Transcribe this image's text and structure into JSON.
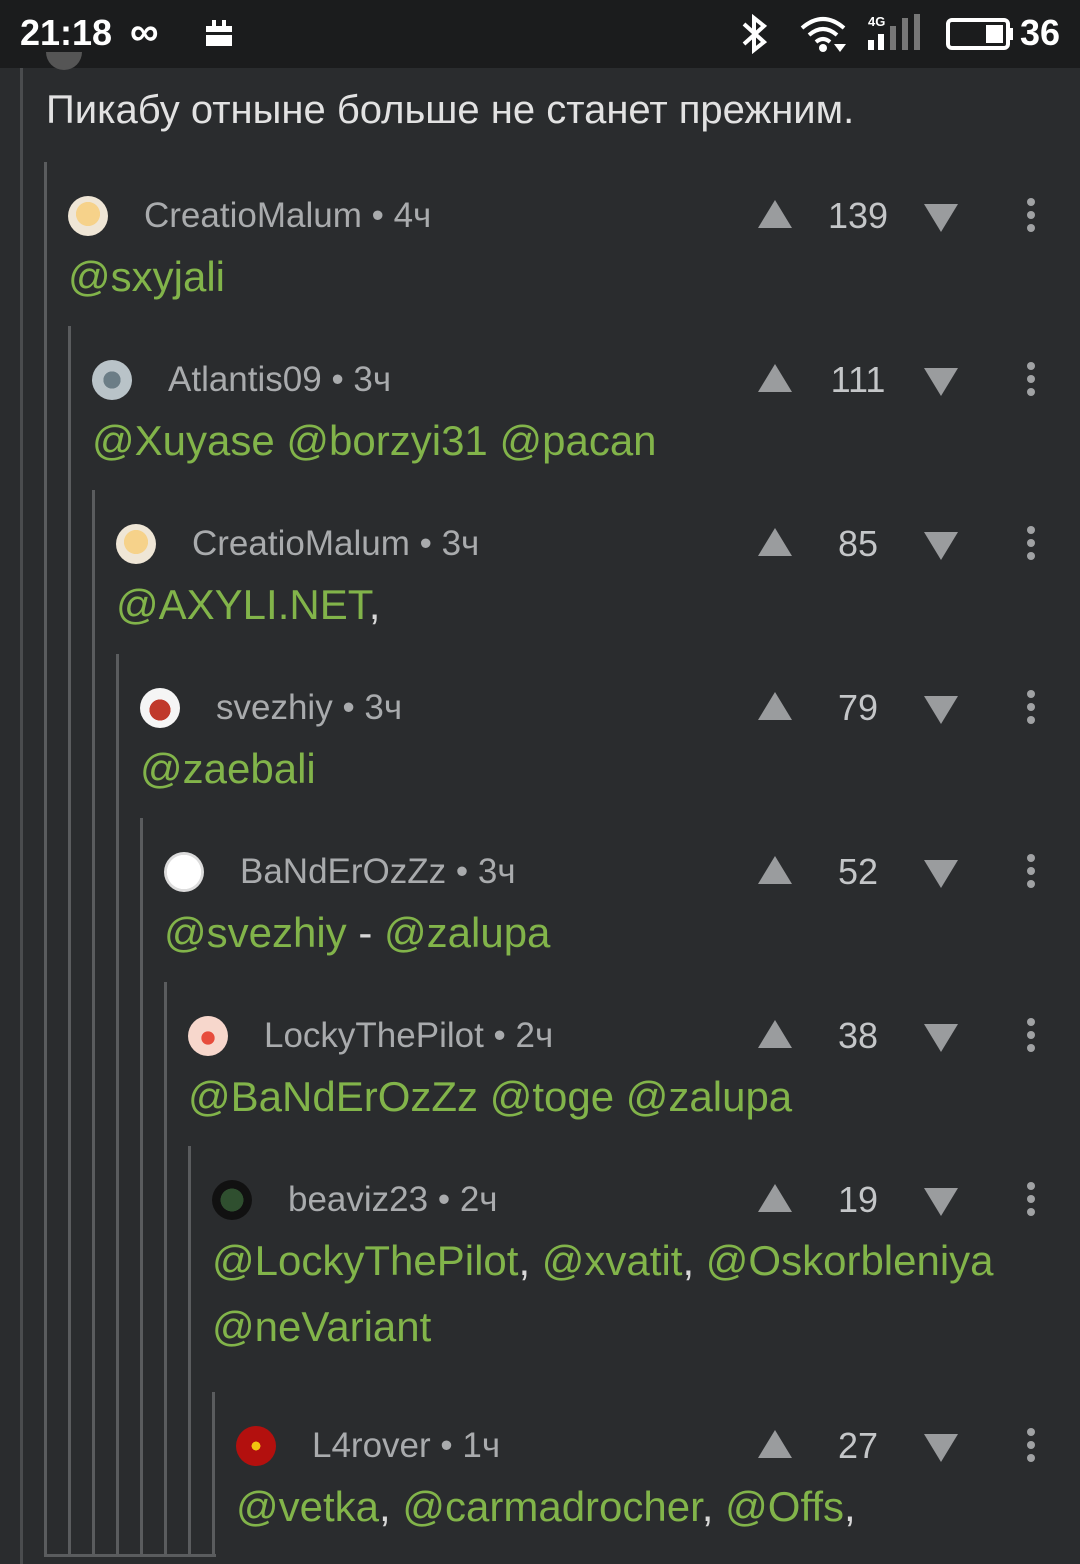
{
  "status_bar": {
    "time": "21:18",
    "infinity": "∞",
    "network": "4G",
    "battery": "36"
  },
  "parent_comment_text": "Пикабу отныне больше не станет прежним.",
  "comments": [
    {
      "author": "CreatioMalum",
      "time": "4ч",
      "score": "139",
      "mentions": [
        "@sxyjali"
      ],
      "seps": [
        ""
      ]
    },
    {
      "author": "Atlantis09",
      "time": "3ч",
      "score": "111",
      "mentions": [
        "@Xuyase",
        "@borzyi31",
        "@pacan"
      ],
      "seps": [
        " ",
        " ",
        ""
      ]
    },
    {
      "author": "CreatioMalum",
      "time": "3ч",
      "score": "85",
      "mentions": [
        "@AXYLI.NET"
      ],
      "seps": [
        ","
      ]
    },
    {
      "author": "svezhiy",
      "time": "3ч",
      "score": "79",
      "mentions": [
        "@zaebali"
      ],
      "seps": [
        ""
      ]
    },
    {
      "author": "BaNdErOzZz",
      "time": "3ч",
      "score": "52",
      "mentions": [
        "@svezhiy",
        "@zalupa"
      ],
      "seps": [
        " - ",
        ""
      ]
    },
    {
      "author": "LockyThePilot",
      "time": "2ч",
      "score": "38",
      "mentions": [
        "@BaNdErOzZz",
        "@toge",
        "@zalupa"
      ],
      "seps": [
        " ",
        " ",
        ""
      ]
    },
    {
      "author": "beaviz23",
      "time": "2ч",
      "score": "19",
      "mentions": [
        "@LockyThePilot",
        "@xvatit",
        "@Oskorbleniya"
      ],
      "seps": [
        ", ",
        ", ",
        ""
      ],
      "mentions_line2": [
        "@neVariant"
      ]
    },
    {
      "author": "L4rover",
      "time": "1ч",
      "score": "27",
      "mentions": [
        "@vetka",
        "@carmadrocher",
        "@Offs"
      ],
      "seps": [
        ", ",
        ", ",
        ","
      ]
    }
  ],
  "meta_separator": "•",
  "colors": {
    "mention": "#82b44a",
    "background": "#2a2c2e",
    "statusbar": "#1b1c1d"
  }
}
